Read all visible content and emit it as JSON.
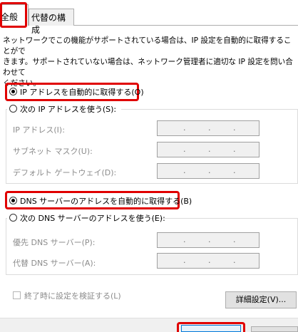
{
  "tabs": [
    {
      "label": "全般"
    },
    {
      "label": "代替の構成"
    }
  ],
  "description": "ネットワークでこの機能がサポートされている場合は、IP 設定を自動的に取得することがで\nきます。サポートされていない場合は、ネットワーク管理者に適切な IP 設定を問い合わせて\nください。",
  "ip": {
    "auto_label": "IP アドレスを自動的に取得する(O)",
    "auto_selected": true,
    "manual_label": "次の IP アドレスを使う(S):",
    "manual_selected": false,
    "fields": [
      {
        "label": "IP アドレス(I):",
        "value": ". . ."
      },
      {
        "label": "サブネット マスク(U):",
        "value": ". . ."
      },
      {
        "label": "デフォルト ゲートウェイ(D):",
        "value": ". . ."
      }
    ]
  },
  "dns": {
    "auto_label": "DNS サーバーのアドレスを自動的に取得する(B)",
    "auto_selected": true,
    "manual_label": "次の DNS サーバーのアドレスを使う(E):",
    "manual_selected": false,
    "fields": [
      {
        "label": "優先 DNS サーバー(P):",
        "value": ". . ."
      },
      {
        "label": "代替 DNS サーバー(A):",
        "value": ". . ."
      }
    ]
  },
  "validate_label": "終了時に設定を検証する(L)",
  "advanced_button": "詳細設定(V)...",
  "highlight_color": "#e00000"
}
